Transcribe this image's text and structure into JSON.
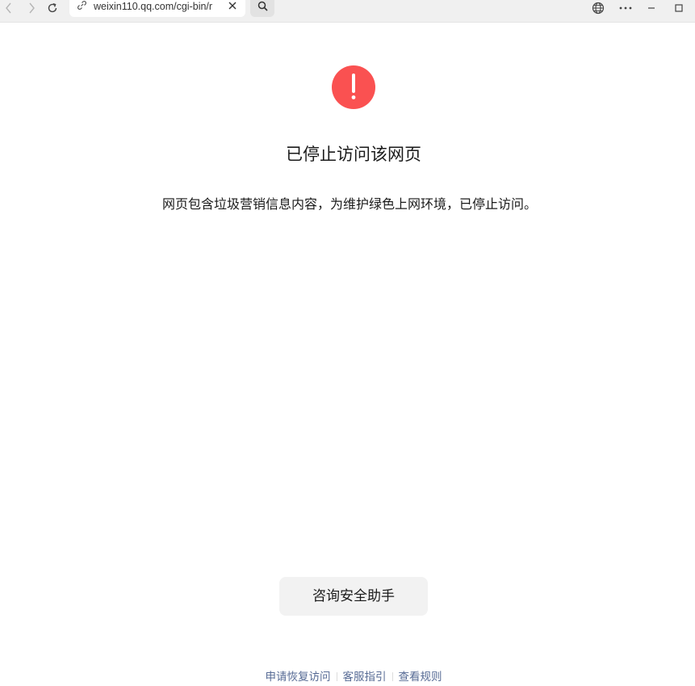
{
  "browser": {
    "url": "weixin110.qq.com/cgi-bin/r",
    "icons": {
      "back": "chevron-left-icon",
      "forward": "chevron-right-icon",
      "reload": "reload-icon",
      "link": "link-icon",
      "clear": "close-icon",
      "search": "search-icon",
      "translate": "globe-icon",
      "more": "more-icon",
      "minimize": "minimize-icon",
      "maximize": "maximize-icon"
    }
  },
  "page": {
    "warning_icon": "exclamation-icon",
    "warning_color": "#fa5151",
    "title": "已停止访问该网页",
    "description": "网页包含垃圾营销信息内容，为维护绿色上网环境，已停止访问。",
    "consult_button": "咨询安全助手",
    "link_color": "#576b95",
    "footer_links": [
      "申请恢复访问",
      "客服指引",
      "查看规则"
    ]
  }
}
